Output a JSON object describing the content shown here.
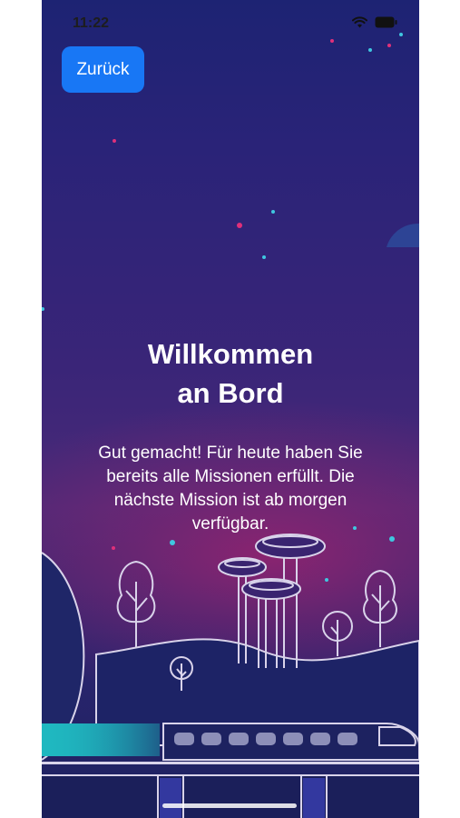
{
  "status_bar": {
    "time": "11:22",
    "icons": [
      "wifi-icon",
      "battery-icon"
    ]
  },
  "nav": {
    "back_label": "Zurück"
  },
  "welcome": {
    "title_line1": "Willkommen",
    "title_line2": "an Bord",
    "message": "Gut gemacht! Für heute haben Sie bereits alle Missionen erfüllt. Die nächste Mission ist ab morgen verfügbar."
  },
  "colors": {
    "accent": "#1877f5",
    "background_top": "#1d2373",
    "glow": "#8a2470",
    "teal": "#1fb8c0"
  }
}
